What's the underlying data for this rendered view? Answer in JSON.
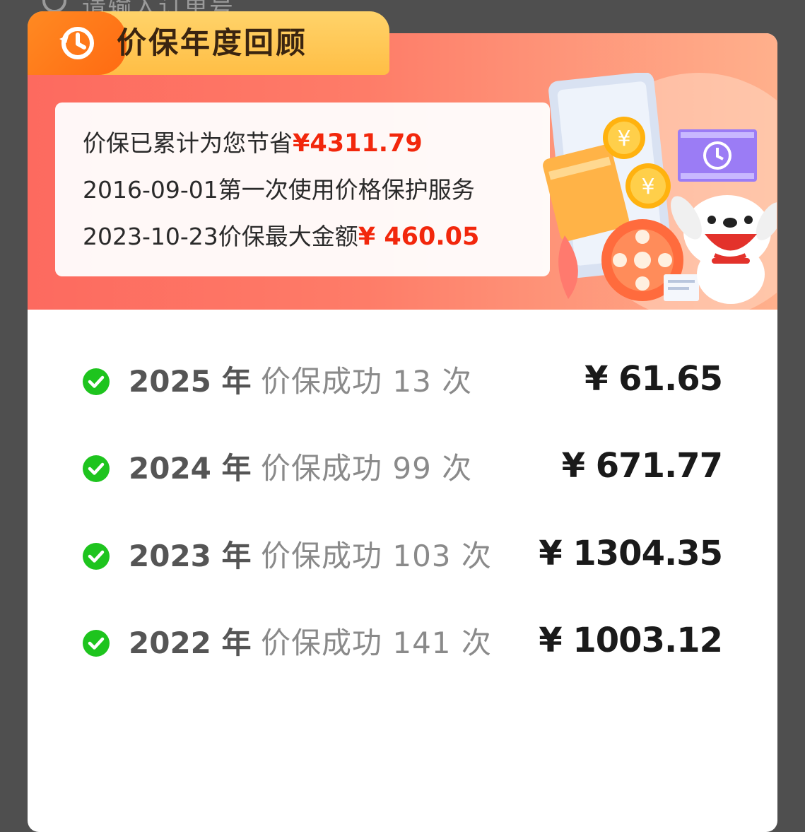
{
  "search": {
    "placeholder": "请输入订单号"
  },
  "header": {
    "title": "价保年度回顾"
  },
  "summary": {
    "line1_prefix": "价保已累计为您节省",
    "line1_amount": "¥4311.79",
    "line2": "2016-09-01第一次使用价格保护服务",
    "line3_prefix": "2023-10-23价保最大金额",
    "line3_amount": "¥ 460.05"
  },
  "records": [
    {
      "year": "2025 年",
      "count": "价保成功 13 次",
      "amount": "¥ 61.65"
    },
    {
      "year": "2024 年",
      "count": "价保成功 99 次",
      "amount": "¥ 671.77"
    },
    {
      "year": "2023 年",
      "count": "价保成功 103 次",
      "amount": "¥ 1304.35"
    },
    {
      "year": "2022 年",
      "count": "价保成功 141 次",
      "amount": "¥ 1003.12"
    }
  ],
  "colors": {
    "accent_red": "#f2270c",
    "success_green": "#1ec41e",
    "ribbon_orange": "#ff7a1a",
    "ribbon_yellow": "#ffc44e"
  },
  "icons": {
    "header_icon": "history-clock-icon",
    "row_icon": "check-circle-icon"
  }
}
